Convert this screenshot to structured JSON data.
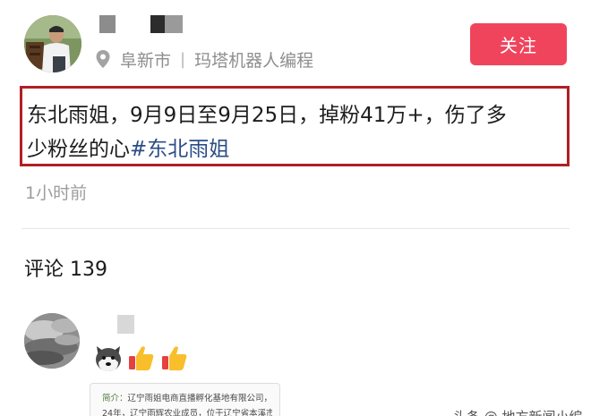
{
  "header": {
    "location": "阜新市",
    "separator": "|",
    "company": "玛塔机器人编程",
    "follow_label": "关注"
  },
  "post": {
    "text_line1": "东北雨姐，9月9日至9月25日，掉粉41万+，伤了多",
    "text_line2_prefix": "少粉丝的心",
    "hashtag": "#东北雨姐",
    "timestamp": "1小时前"
  },
  "comments": {
    "title": "评论 139",
    "first_comment": {
      "emojis": [
        "dog-face-icon",
        "thumbs-up-icon",
        "thumbs-up-icon"
      ],
      "card_lines": [
        {
          "lead": "简介：",
          "text": "辽宁雨姐电商直播孵化基地有限公司，成立于20"
        },
        {
          "lead": "",
          "text": "24年，辽宁雨辉农业成员，位于辽宁省本溪市，是一家"
        }
      ]
    }
  },
  "watermark": "头条 @ 地方新闻小编",
  "colors": {
    "follow_button": "#f0445d",
    "highlight_border": "#b01f25",
    "hashtag": "#2b4d86"
  }
}
